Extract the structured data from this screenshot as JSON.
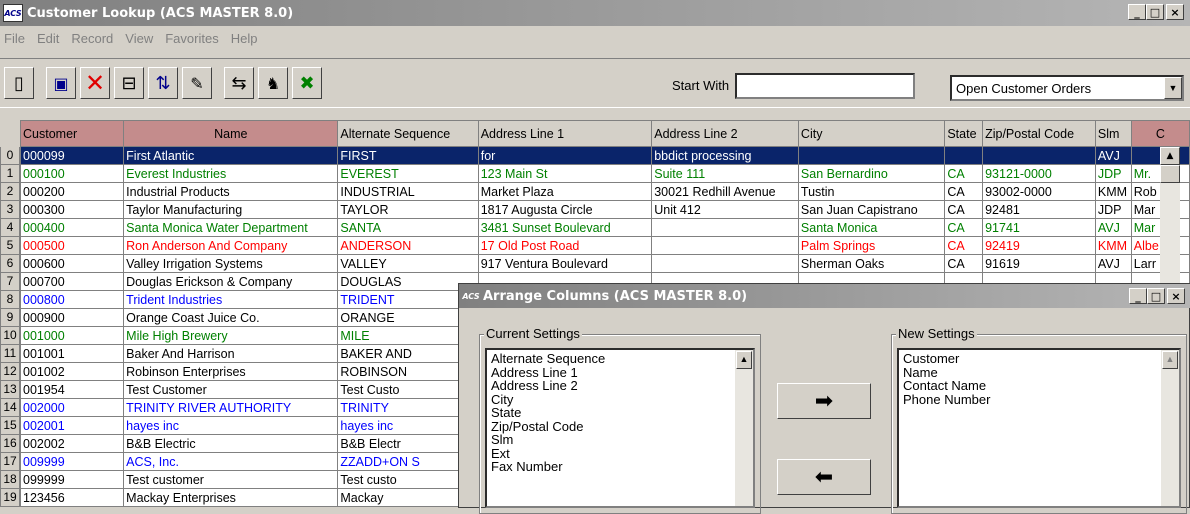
{
  "window": {
    "title": "Customer Lookup (ACS MASTER 8.0)",
    "logo_text": "ACS",
    "controls": {
      "minimize": "_",
      "maximize": "□",
      "close": "×"
    }
  },
  "menu": [
    "File",
    "Edit",
    "Record",
    "View",
    "Favorites",
    "Help"
  ],
  "toolbar": {
    "tools": [
      {
        "name": "new-doc-icon",
        "glyph": "🗋"
      },
      {
        "name": "save-icon",
        "glyph": "💾"
      },
      {
        "name": "delete-icon",
        "glyph": "✕"
      },
      {
        "name": "insert-column-icon",
        "glyph": "⇥"
      },
      {
        "name": "arrange-icon",
        "glyph": "⇅"
      },
      {
        "name": "notes-icon",
        "glyph": "📝"
      },
      {
        "name": "swap-icon",
        "glyph": "⇆"
      },
      {
        "name": "find-icon",
        "glyph": "🔭"
      },
      {
        "name": "excel-icon",
        "glyph": "X"
      }
    ],
    "start_with_label": "Start With",
    "start_with_value": "",
    "view_select": "Open Customer Orders"
  },
  "grid": {
    "columns": [
      "Customer",
      "Name",
      "Alternate Sequence",
      "Address Line 1",
      "Address Line 2",
      "City",
      "State",
      "Zip/Postal Code",
      "Slm",
      "C"
    ],
    "row_numbers": [
      "0",
      "1",
      "2",
      "3",
      "4",
      "5",
      "6",
      "7",
      "8",
      "9",
      "10",
      "11",
      "12",
      "13",
      "14",
      "15",
      "16",
      "17",
      "18",
      "19"
    ],
    "rows": [
      [
        "000099",
        "First Atlantic",
        "FIRST",
        "for",
        "bbdict processing",
        "",
        "",
        "",
        "AVJ",
        ""
      ],
      [
        "000100",
        "Everest Industries",
        "EVEREST",
        "123 Main St",
        "Suite 111",
        "San Bernardino",
        "CA",
        "93121-0000",
        "JDP",
        "Mr."
      ],
      [
        "000200",
        "Industrial Products",
        "INDUSTRIAL",
        "Market Plaza",
        "30021 Redhill Avenue",
        "Tustin",
        "CA",
        "93002-0000",
        "KMM",
        "Rob"
      ],
      [
        "000300",
        "Taylor Manufacturing",
        "TAYLOR",
        "1817 Augusta Circle",
        "Unit 412",
        "San Juan Capistrano",
        "CA",
        "92481",
        "JDP",
        "Mar"
      ],
      [
        "000400",
        "Santa Monica Water Department",
        "SANTA",
        "3481 Sunset Boulevard",
        "",
        "Santa Monica",
        "CA",
        "91741",
        "AVJ",
        "Mar"
      ],
      [
        "000500",
        "Ron Anderson And Company",
        "ANDERSON",
        "17 Old Post Road",
        "",
        "Palm Springs",
        "CA",
        "92419",
        "KMM",
        "Albe"
      ],
      [
        "000600",
        "Valley Irrigation Systems",
        "VALLEY",
        "917 Ventura Boulevard",
        "",
        "Sherman Oaks",
        "CA",
        "91619",
        "AVJ",
        "Larr"
      ],
      [
        "000700",
        "Douglas Erickson & Company",
        "DOUGLAS",
        "",
        "",
        "",
        "",
        "",
        "",
        ""
      ],
      [
        "000800",
        "Trident Industries",
        "TRIDENT",
        "",
        "",
        "",
        "",
        "",
        "",
        ""
      ],
      [
        "000900",
        "Orange Coast Juice Co.",
        "ORANGE",
        "",
        "",
        "",
        "",
        "",
        "",
        ""
      ],
      [
        "001000",
        "Mile High Brewery",
        "MILE",
        "",
        "",
        "",
        "",
        "",
        "",
        ""
      ],
      [
        "001001",
        "Baker And Harrison",
        "BAKER AND",
        "",
        "",
        "",
        "",
        "",
        "",
        ""
      ],
      [
        "001002",
        "Robinson Enterprises",
        "ROBINSON",
        "",
        "",
        "",
        "",
        "",
        "",
        ""
      ],
      [
        "001954",
        "Test Customer",
        "Test Custo",
        "",
        "",
        "",
        "",
        "",
        "",
        ""
      ],
      [
        "002000",
        "TRINITY RIVER AUTHORITY",
        "TRINITY",
        "",
        "",
        "",
        "",
        "",
        "",
        ""
      ],
      [
        "002001",
        "hayes inc",
        "hayes inc",
        "",
        "",
        "",
        "",
        "",
        "",
        ""
      ],
      [
        "002002",
        "B&B Electric",
        "B&B Electr",
        "",
        "",
        "",
        "",
        "",
        "",
        ""
      ],
      [
        "009999",
        "ACS, Inc.",
        "ZZADD+ON S",
        "",
        "",
        "",
        "",
        "",
        "",
        ""
      ],
      [
        "099999",
        "Test customer",
        "Test custo",
        "",
        "",
        "",
        "",
        "",
        "",
        ""
      ],
      [
        "123456",
        "Mackay Enterprises",
        "Mackay",
        "",
        "",
        "",
        "",
        "",
        "",
        ""
      ]
    ],
    "row_colors": [
      "selected",
      "green",
      "black",
      "black",
      "green",
      "red",
      "black",
      "black",
      "blue",
      "black",
      "green",
      "black",
      "black",
      "black",
      "blue",
      "blue",
      "black",
      "blue",
      "black",
      "black"
    ]
  },
  "dialog": {
    "title": "Arrange Columns (ACS MASTER 8.0)",
    "logo_text": "ACS",
    "current_label": "Current Settings",
    "current_items": [
      "Alternate Sequence",
      "Address Line 1",
      "Address Line 2",
      "City",
      "State",
      "Zip/Postal Code",
      "Slm",
      "Ext",
      "Fax Number"
    ],
    "new_label": "New Settings",
    "new_items": [
      "Customer",
      "Name",
      "Contact Name",
      "Phone Number"
    ],
    "add_arrow": "➡",
    "remove_arrow": "⬅"
  }
}
